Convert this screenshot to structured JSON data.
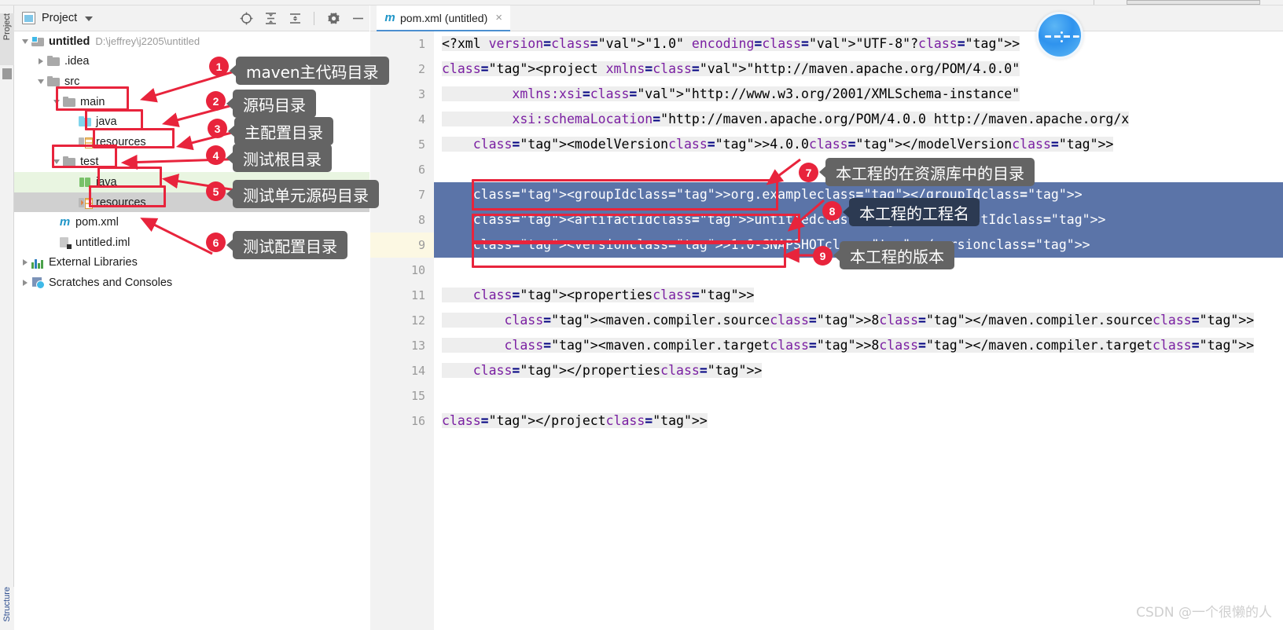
{
  "window": {
    "left_rail_label": "Project",
    "left_rail_bottom_label": "Structure"
  },
  "project_panel": {
    "title": "Project",
    "title_icon": "project-panel-icon",
    "tools": [
      {
        "name": "locate-icon",
        "glyph": "locate"
      },
      {
        "name": "expand-all-icon",
        "glyph": "expand"
      },
      {
        "name": "collapse-all-icon",
        "glyph": "collapse"
      },
      {
        "name": "settings-gear-icon",
        "glyph": "gear"
      },
      {
        "name": "hide-panel-icon",
        "glyph": "minus"
      }
    ],
    "tree": [
      {
        "indent": 0,
        "twisty": "down",
        "icon": "module-folder-icon",
        "label": "untitled",
        "bold": true,
        "path": "D:\\jeffrey\\j2205\\untitled",
        "row_state": "none"
      },
      {
        "indent": 1,
        "twisty": "right",
        "icon": "folder-icon",
        "label": ".idea",
        "bold": false,
        "path": "",
        "row_state": "none"
      },
      {
        "indent": 1,
        "twisty": "down",
        "icon": "folder-icon",
        "label": "src",
        "bold": false,
        "path": "",
        "row_state": "none"
      },
      {
        "indent": 2,
        "twisty": "down",
        "icon": "folder-icon",
        "label": "main",
        "bold": false,
        "path": "",
        "row_state": "none"
      },
      {
        "indent": 3,
        "twisty": "none",
        "icon": "source-root-icon",
        "label": "java",
        "bold": false,
        "path": "",
        "row_state": "none"
      },
      {
        "indent": 3,
        "twisty": "none",
        "icon": "resources-root-icon",
        "label": "resources",
        "bold": false,
        "path": "",
        "row_state": "none"
      },
      {
        "indent": 2,
        "twisty": "down",
        "icon": "folder-icon",
        "label": "test",
        "bold": false,
        "path": "",
        "row_state": "none"
      },
      {
        "indent": 3,
        "twisty": "none",
        "icon": "test-source-root-icon",
        "label": "java",
        "bold": false,
        "path": "",
        "row_state": "green"
      },
      {
        "indent": 3,
        "twisty": "none",
        "icon": "test-resources-icon",
        "label": "resources",
        "bold": false,
        "path": "",
        "row_state": "gray"
      },
      {
        "indent": 2,
        "twisty": "none",
        "icon": "maven-file-icon",
        "label": "pom.xml",
        "bold": false,
        "path": "",
        "row_state": "none"
      },
      {
        "indent": 2,
        "twisty": "none",
        "icon": "iml-file-icon",
        "label": "untitled.iml",
        "bold": false,
        "path": "",
        "row_state": "none"
      },
      {
        "indent": 0,
        "twisty": "right",
        "icon": "external-libraries-icon",
        "label": "External Libraries",
        "bold": false,
        "path": "",
        "row_state": "none"
      },
      {
        "indent": 0,
        "twisty": "right",
        "icon": "scratches-icon",
        "label": "Scratches and Consoles",
        "bold": false,
        "path": "",
        "row_state": "none"
      }
    ]
  },
  "editor": {
    "tab": {
      "icon": "maven-file-icon",
      "label": "pom.xml (untitled)",
      "close": "×"
    },
    "lines": [
      {
        "n": "1",
        "fold": "none",
        "state": "none"
      },
      {
        "n": "2",
        "fold": "minus",
        "state": "none"
      },
      {
        "n": "3",
        "fold": "none",
        "state": "none"
      },
      {
        "n": "4",
        "fold": "none",
        "state": "none"
      },
      {
        "n": "5",
        "fold": "none",
        "state": "none"
      },
      {
        "n": "6",
        "fold": "none",
        "state": "none"
      },
      {
        "n": "7",
        "fold": "none",
        "state": "selected"
      },
      {
        "n": "8",
        "fold": "none",
        "state": "selected"
      },
      {
        "n": "9",
        "fold": "none",
        "state": "selected-caret"
      },
      {
        "n": "10",
        "fold": "none",
        "state": "none"
      },
      {
        "n": "11",
        "fold": "minus",
        "state": "none"
      },
      {
        "n": "12",
        "fold": "none",
        "state": "none"
      },
      {
        "n": "13",
        "fold": "none",
        "state": "none"
      },
      {
        "n": "14",
        "fold": "end",
        "state": "none"
      },
      {
        "n": "15",
        "fold": "none",
        "state": "none"
      },
      {
        "n": "16",
        "fold": "end",
        "state": "none"
      }
    ],
    "code": {
      "l1": "<?xml version=\"1.0\" encoding=\"UTF-8\"?>",
      "l2": "<project xmlns=\"http://maven.apache.org/POM/4.0.0\"",
      "l3": "         xmlns:xsi=\"http://www.w3.org/2001/XMLSchema-instance\"",
      "l4": "         xsi:schemaLocation=\"http://maven.apache.org/POM/4.0.0 http://maven.apache.org/x",
      "l5": "    <modelVersion>4.0.0</modelVersion>",
      "l6": "",
      "l7": "    <groupId>org.example</groupId>",
      "l8": "    <artifactId>untitled</artifactId>",
      "l9": "    <version>1.0-SNAPSHOT</version>",
      "l10": "",
      "l11": "    <properties>",
      "l12": "        <maven.compiler.source>8</maven.compiler.source>",
      "l13": "        <maven.compiler.target>8</maven.compiler.target>",
      "l14": "    </properties>",
      "l15": "",
      "l16": "</project>"
    }
  },
  "annotations": [
    {
      "num": "1",
      "label": "maven主代码目录",
      "style": "gray"
    },
    {
      "num": "2",
      "label": "源码目录",
      "style": "gray"
    },
    {
      "num": "3",
      "label": "主配置目录",
      "style": "gray"
    },
    {
      "num": "4",
      "label": "测试根目录",
      "style": "gray"
    },
    {
      "num": "5",
      "label": "测试单元源码目录",
      "style": "gray"
    },
    {
      "num": "6",
      "label": "测试配置目录",
      "style": "gray"
    },
    {
      "num": "7",
      "label": "本工程的在资源库中的目录",
      "style": "gray"
    },
    {
      "num": "8",
      "label": "本工程的工程名",
      "style": "dark"
    },
    {
      "num": "9",
      "label": "本工程的版本",
      "style": "gray"
    }
  ],
  "watermark": "CSDN @一个很懒的人",
  "colors": {
    "accent_red": "#e8243c",
    "bubble_gray": "#646464",
    "bubble_dark": "#2c3a52",
    "selection_blue": "#5b74a8",
    "tab_underline": "#4b8fd0"
  }
}
